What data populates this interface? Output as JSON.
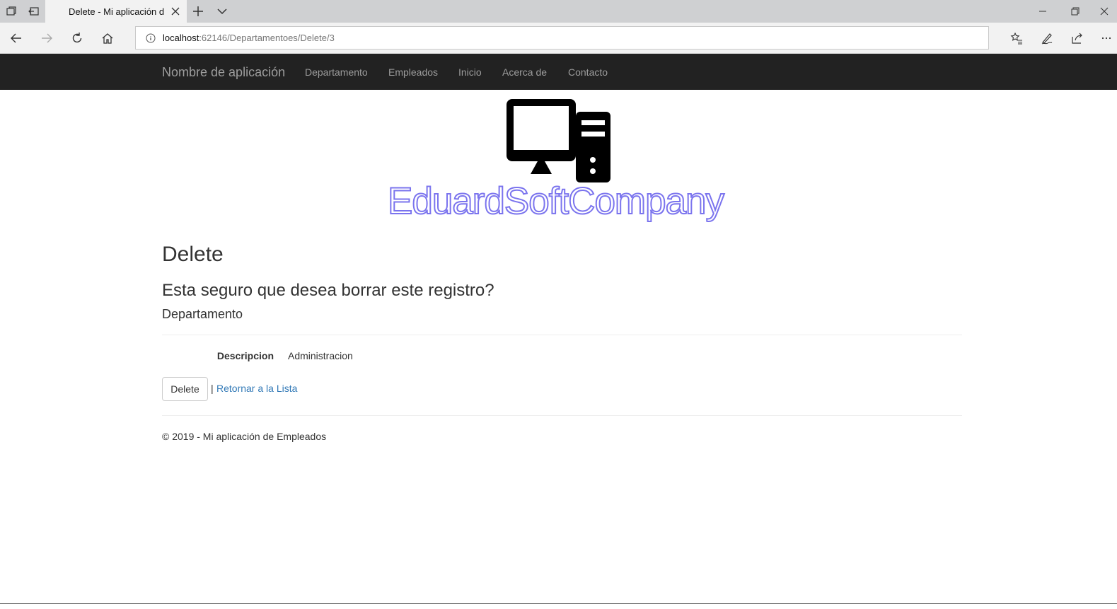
{
  "browser": {
    "tab_title": "Delete - Mi aplicación d",
    "url_host": "localhost",
    "url_path": ":62146/Departamentoes/Delete/3"
  },
  "nav": {
    "brand": "Nombre de aplicación",
    "links": [
      "Departamento",
      "Empleados",
      "Inicio",
      "Acerca de",
      "Contacto"
    ]
  },
  "logo": {
    "text": "EduardSoftCompany",
    "outline_color": "#7b74ee"
  },
  "page": {
    "title": "Delete",
    "question": "Esta seguro que desea borrar este registro?",
    "entity": "Departamento",
    "field_label": "Descripcion",
    "field_value": "Administracion",
    "delete_button": "Delete",
    "separator": "|",
    "back_link": "Retornar a la Lista"
  },
  "footer": {
    "text": "© 2019 - Mi aplicación de Empleados"
  },
  "colors": {
    "navbar_bg": "#222222",
    "link": "#337ab7"
  }
}
